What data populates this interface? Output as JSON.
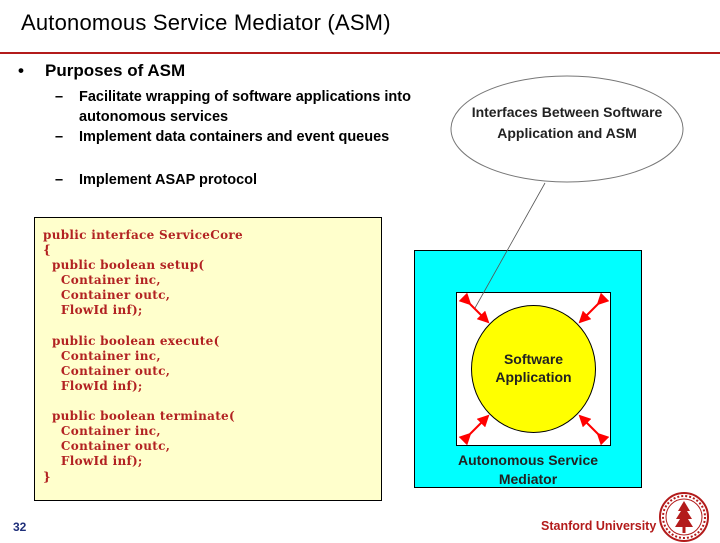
{
  "slide": {
    "title": "Autonomous Service Mediator (ASM)",
    "bullet": {
      "marker": "•",
      "text": "Purposes of ASM"
    },
    "sub_bullets": [
      {
        "marker": "–",
        "text": "Facilitate wrapping of software applications into autonomous services"
      },
      {
        "marker": "–",
        "text": "Implement data containers and event queues"
      },
      {
        "marker": "–",
        "text": "Implement ASAP protocol"
      }
    ],
    "code": "public interface ServiceCore\n{\n  public boolean setup(\n    Container inc,\n    Container outc,\n    FlowId inf);\n\n  public boolean execute(\n    Container inc,\n    Container outc,\n    FlowId inf);\n\n  public boolean terminate(\n    Container inc,\n    Container outc,\n    FlowId inf);\n}",
    "callout": {
      "line1": "Interfaces Between Software",
      "line2": "Application and ASM"
    },
    "diagram": {
      "inner_label_line1": "Software",
      "inner_label_line2": "Application",
      "outer_label_line1": "Autonomous Service",
      "outer_label_line2": "Mediator",
      "colors": {
        "outer": "#00ffff",
        "inner_box": "#ffffff",
        "circle": "#ffff00",
        "arrows": "#ff0000"
      }
    },
    "footer": {
      "page_number": "32",
      "university": "Stanford University",
      "logo": "stanford-seal-icon"
    },
    "colors": {
      "rule": "#b31b1b",
      "code_text": "#b22222",
      "code_bg": "#ffffcc",
      "page_number": "#1f2f7a"
    }
  }
}
